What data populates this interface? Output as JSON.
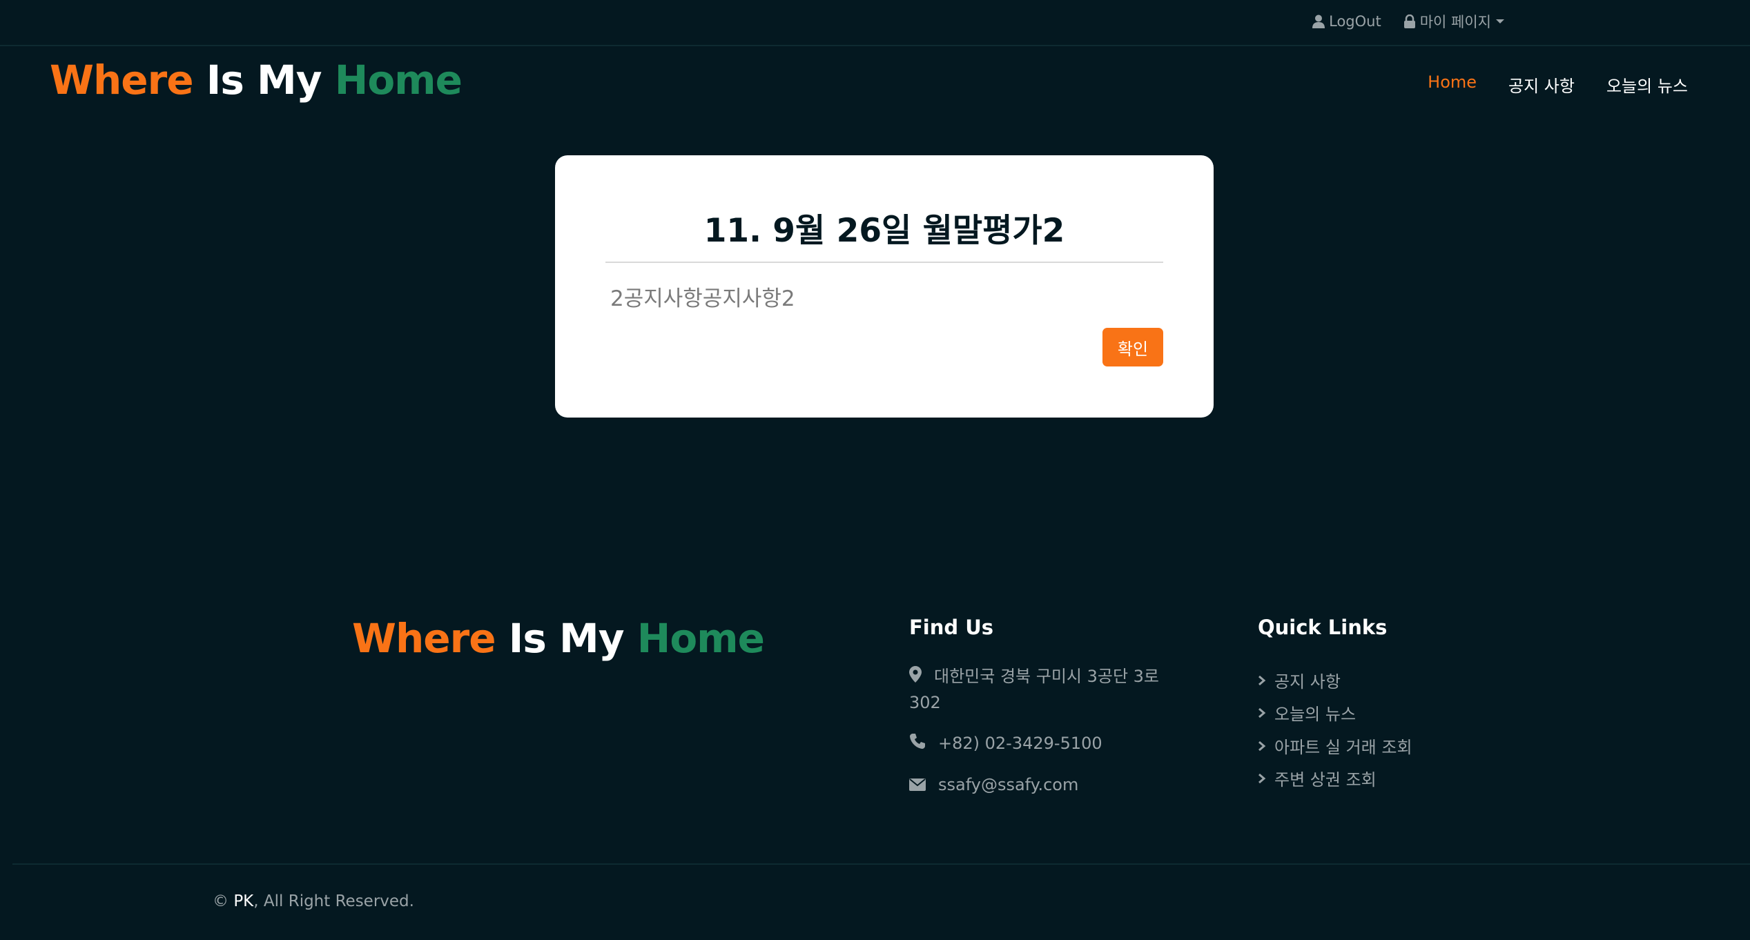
{
  "topbar": {
    "logout_label": "LogOut",
    "mypage_label": "마이 페이지"
  },
  "brand": {
    "part1": "Where",
    "part2": "Is My",
    "part3": "Home"
  },
  "nav": {
    "items": [
      {
        "label": "Home",
        "active": true
      },
      {
        "label": "공지 사항",
        "active": false
      },
      {
        "label": "오늘의 뉴스",
        "active": false
      }
    ]
  },
  "notice": {
    "title": "11. 9월 26일 월말평가2",
    "content": "2공지사항공지사항2",
    "confirm_label": "확인"
  },
  "footer": {
    "brand": {
      "part1": "Where",
      "part2": "Is My",
      "part3": "Home"
    },
    "find_us": {
      "title": "Find Us",
      "address_line1": "대한민국 경북 구미시 3공단 3로",
      "address_line2": "302",
      "phone": "+82) 02-3429-5100",
      "email": "ssafy@ssafy.com"
    },
    "quick_links": {
      "title": "Quick Links",
      "items": [
        "공지 사항",
        "오늘의 뉴스",
        "아파트 실 거래 조회",
        "주변 상권 조회"
      ]
    },
    "copyright": {
      "prefix": "© ",
      "owner": "PK",
      "suffix": ", All Right Reserved."
    }
  },
  "colors": {
    "background": "#041820",
    "accent": "#f97316",
    "brand_green": "#1e8a5b"
  }
}
